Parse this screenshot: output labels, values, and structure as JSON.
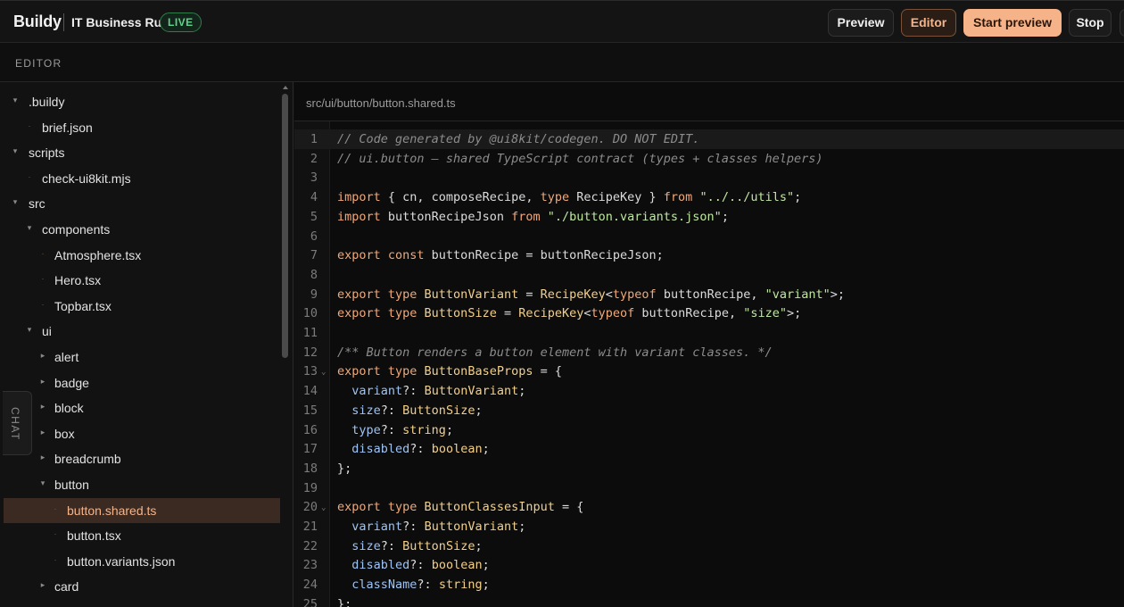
{
  "app": {
    "brand": "Buildy",
    "project": "IT Business Ru",
    "status_badge": "LIVE"
  },
  "toolbar": {
    "preview_label": "Preview",
    "editor_label": "Editor",
    "start_preview_label": "Start preview",
    "stop_label": "Stop"
  },
  "section_label": "EDITOR",
  "chat_tab_label": "CHAT",
  "tree": [
    {
      "label": ".buildy",
      "kind": "folder",
      "depth": 0,
      "expanded": true
    },
    {
      "label": "brief.json",
      "kind": "file",
      "depth": 1
    },
    {
      "label": "scripts",
      "kind": "folder",
      "depth": 0,
      "expanded": true
    },
    {
      "label": "check-ui8kit.mjs",
      "kind": "file",
      "depth": 1
    },
    {
      "label": "src",
      "kind": "folder",
      "depth": 0,
      "expanded": true
    },
    {
      "label": "components",
      "kind": "folder",
      "depth": 1,
      "expanded": true
    },
    {
      "label": "Atmosphere.tsx",
      "kind": "file",
      "depth": 2
    },
    {
      "label": "Hero.tsx",
      "kind": "file",
      "depth": 2
    },
    {
      "label": "Topbar.tsx",
      "kind": "file",
      "depth": 2
    },
    {
      "label": "ui",
      "kind": "folder",
      "depth": 1,
      "expanded": true
    },
    {
      "label": "alert",
      "kind": "folder",
      "depth": 2,
      "expanded": false
    },
    {
      "label": "badge",
      "kind": "folder",
      "depth": 2,
      "expanded": false
    },
    {
      "label": "block",
      "kind": "folder",
      "depth": 2,
      "expanded": false
    },
    {
      "label": "box",
      "kind": "folder",
      "depth": 2,
      "expanded": false
    },
    {
      "label": "breadcrumb",
      "kind": "folder",
      "depth": 2,
      "expanded": false
    },
    {
      "label": "button",
      "kind": "folder",
      "depth": 2,
      "expanded": true
    },
    {
      "label": "button.shared.ts",
      "kind": "file",
      "depth": 3,
      "selected": true
    },
    {
      "label": "button.tsx",
      "kind": "file",
      "depth": 3
    },
    {
      "label": "button.variants.json",
      "kind": "file",
      "depth": 3
    },
    {
      "label": "card",
      "kind": "folder",
      "depth": 2,
      "expanded": false
    }
  ],
  "editor": {
    "file_path": "src/ui/button/button.shared.ts",
    "lines": [
      {
        "n": "1",
        "tokens": [
          [
            "cm",
            "// Code generated by @ui8kit/codegen. DO NOT EDIT."
          ]
        ]
      },
      {
        "n": "2",
        "tokens": [
          [
            "cm",
            "// ui.button — shared TypeScript contract (types + classes helpers)"
          ]
        ]
      },
      {
        "n": "3",
        "tokens": []
      },
      {
        "n": "4",
        "tokens": [
          [
            "kw",
            "import"
          ],
          [
            "pun",
            " { cn, composeRecipe, "
          ],
          [
            "kw",
            "type"
          ],
          [
            "pun",
            " RecipeKey } "
          ],
          [
            "kw",
            "from"
          ],
          [
            "pun",
            " "
          ],
          [
            "str",
            "\"../../utils\""
          ],
          [
            "pun",
            ";"
          ]
        ]
      },
      {
        "n": "5",
        "tokens": [
          [
            "kw",
            "import"
          ],
          [
            "pun",
            " buttonRecipeJson "
          ],
          [
            "kw",
            "from"
          ],
          [
            "pun",
            " "
          ],
          [
            "str",
            "\"./button.variants.json\""
          ],
          [
            "pun",
            ";"
          ]
        ]
      },
      {
        "n": "6",
        "tokens": []
      },
      {
        "n": "7",
        "tokens": [
          [
            "kw",
            "export const"
          ],
          [
            "pun",
            " buttonRecipe = buttonRecipeJson;"
          ]
        ]
      },
      {
        "n": "8",
        "tokens": []
      },
      {
        "n": "9",
        "tokens": [
          [
            "kw",
            "export type"
          ],
          [
            "pun",
            " "
          ],
          [
            "type",
            "ButtonVariant"
          ],
          [
            "pun",
            " = "
          ],
          [
            "type",
            "RecipeKey"
          ],
          [
            "pun",
            "<"
          ],
          [
            "kw",
            "typeof"
          ],
          [
            "pun",
            " buttonRecipe, "
          ],
          [
            "str",
            "\"variant\""
          ],
          [
            "pun",
            ">;"
          ]
        ]
      },
      {
        "n": "10",
        "tokens": [
          [
            "kw",
            "export type"
          ],
          [
            "pun",
            " "
          ],
          [
            "type",
            "ButtonSize"
          ],
          [
            "pun",
            " = "
          ],
          [
            "type",
            "RecipeKey"
          ],
          [
            "pun",
            "<"
          ],
          [
            "kw",
            "typeof"
          ],
          [
            "pun",
            " buttonRecipe, "
          ],
          [
            "str",
            "\"size\""
          ],
          [
            "pun",
            ">;"
          ]
        ]
      },
      {
        "n": "11",
        "tokens": []
      },
      {
        "n": "12",
        "tokens": [
          [
            "cm",
            "/** Button renders a button element with variant classes. */"
          ]
        ]
      },
      {
        "n": "13",
        "fold": true,
        "tokens": [
          [
            "kw",
            "export type"
          ],
          [
            "pun",
            " "
          ],
          [
            "type",
            "ButtonBaseProps"
          ],
          [
            "pun",
            " = {"
          ]
        ]
      },
      {
        "n": "14",
        "tokens": [
          [
            "pun",
            "  "
          ],
          [
            "prop",
            "variant"
          ],
          [
            "pun",
            "?: "
          ],
          [
            "type",
            "ButtonVariant"
          ],
          [
            "pun",
            ";"
          ]
        ]
      },
      {
        "n": "15",
        "tokens": [
          [
            "pun",
            "  "
          ],
          [
            "prop",
            "size"
          ],
          [
            "pun",
            "?: "
          ],
          [
            "type",
            "ButtonSize"
          ],
          [
            "pun",
            ";"
          ]
        ]
      },
      {
        "n": "16",
        "tokens": [
          [
            "pun",
            "  "
          ],
          [
            "prop",
            "type"
          ],
          [
            "pun",
            "?: "
          ],
          [
            "type",
            "string"
          ],
          [
            "pun",
            ";"
          ]
        ]
      },
      {
        "n": "17",
        "tokens": [
          [
            "pun",
            "  "
          ],
          [
            "prop",
            "disabled"
          ],
          [
            "pun",
            "?: "
          ],
          [
            "type",
            "boolean"
          ],
          [
            "pun",
            ";"
          ]
        ]
      },
      {
        "n": "18",
        "tokens": [
          [
            "pun",
            "};"
          ]
        ]
      },
      {
        "n": "19",
        "tokens": []
      },
      {
        "n": "20",
        "fold": true,
        "tokens": [
          [
            "kw",
            "export type"
          ],
          [
            "pun",
            " "
          ],
          [
            "type",
            "ButtonClassesInput"
          ],
          [
            "pun",
            " = {"
          ]
        ]
      },
      {
        "n": "21",
        "tokens": [
          [
            "pun",
            "  "
          ],
          [
            "prop",
            "variant"
          ],
          [
            "pun",
            "?: "
          ],
          [
            "type",
            "ButtonVariant"
          ],
          [
            "pun",
            ";"
          ]
        ]
      },
      {
        "n": "22",
        "tokens": [
          [
            "pun",
            "  "
          ],
          [
            "prop",
            "size"
          ],
          [
            "pun",
            "?: "
          ],
          [
            "type",
            "ButtonSize"
          ],
          [
            "pun",
            ";"
          ]
        ]
      },
      {
        "n": "23",
        "tokens": [
          [
            "pun",
            "  "
          ],
          [
            "prop",
            "disabled"
          ],
          [
            "pun",
            "?: "
          ],
          [
            "type",
            "boolean"
          ],
          [
            "pun",
            ";"
          ]
        ]
      },
      {
        "n": "24",
        "tokens": [
          [
            "pun",
            "  "
          ],
          [
            "prop",
            "className"
          ],
          [
            "pun",
            "?: "
          ],
          [
            "type",
            "string"
          ],
          [
            "pun",
            ";"
          ]
        ]
      },
      {
        "n": "25",
        "tokens": [
          [
            "pun",
            "};"
          ]
        ]
      }
    ]
  },
  "colors": {
    "accent": "#f6b38a",
    "live": "#5fd38a",
    "selected_row": "#3a2a22",
    "keyword": "#f0a97a",
    "string": "#bfe7a0",
    "property": "#9fc3f2",
    "type": "#f3d08a",
    "comment": "#8c8c8c"
  },
  "icons": {
    "folder_expanded": "caret-down-icon",
    "folder_collapsed": "caret-right-icon",
    "file": "dot-icon"
  }
}
